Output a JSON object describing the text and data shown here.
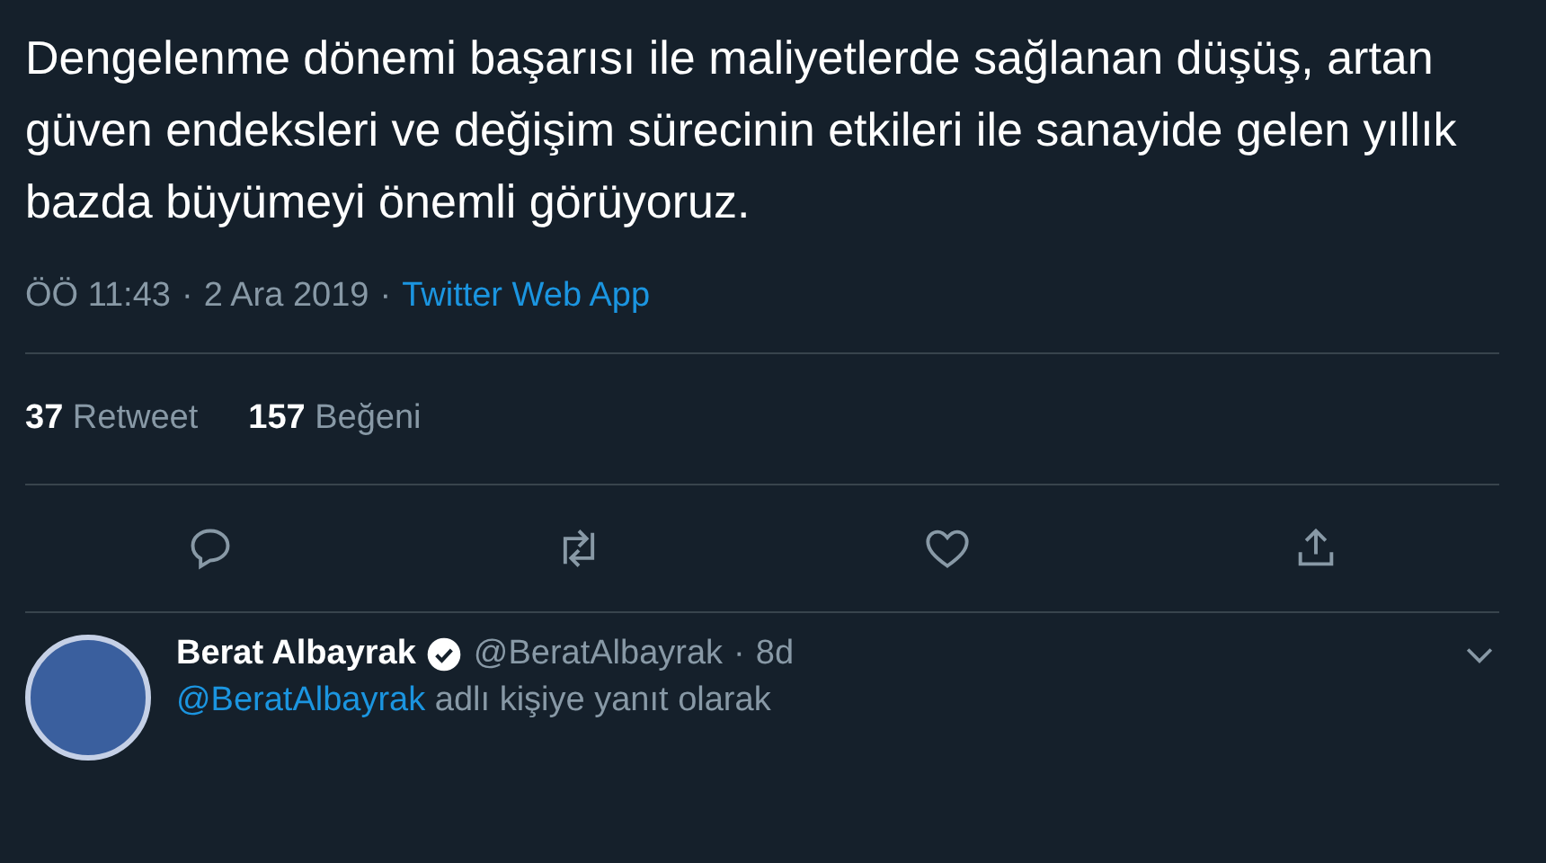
{
  "tweet": {
    "text": "Dengelenme dönemi başarısı ile maliyetlerde sağlanan düşüş, artan güven endeksleri ve değişim sürecinin etkileri ile sanayide gelen yıllık bazda büyümeyi önemli görüyoruz.",
    "time": "ÖÖ 11:43",
    "date": "2 Ara 2019",
    "source": "Twitter Web App",
    "separator": "·"
  },
  "stats": [
    {
      "count": "37",
      "label": "Retweet"
    },
    {
      "count": "157",
      "label": "Beğeni"
    }
  ],
  "actions": [
    {
      "kind": "reply"
    },
    {
      "kind": "retweet"
    },
    {
      "kind": "like"
    },
    {
      "kind": "share"
    }
  ],
  "reply": {
    "name": "Berat Albayrak",
    "verified": true,
    "handle": "@BeratAlbayrak",
    "separator": "·",
    "age": "8d",
    "mention": "@BeratAlbayrak",
    "reply_text": "adlı kişiye yanıt olarak"
  }
}
